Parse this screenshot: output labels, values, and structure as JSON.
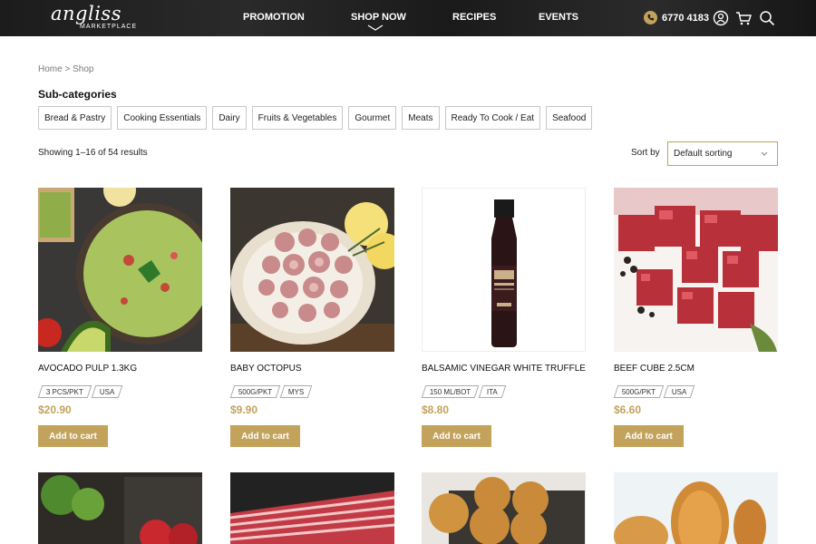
{
  "header": {
    "logo_script": "angliss",
    "logo_sub": "MARKETPLACE",
    "nav": [
      {
        "label": "PROMOTION"
      },
      {
        "label": "SHOP NOW"
      },
      {
        "label": "RECIPES"
      },
      {
        "label": "EVENTS"
      }
    ],
    "phone": "6770 4183",
    "icons": [
      "phone-icon",
      "user-icon",
      "cart-icon",
      "search-icon"
    ]
  },
  "breadcrumb": {
    "home": "Home",
    "separator": ">",
    "current": "Shop"
  },
  "subcategories": {
    "title": "Sub-categories",
    "items": [
      "Bread & Pastry",
      "Cooking Essentials",
      "Dairy",
      "Fruits & Vegetables",
      "Gourmet",
      "Meats",
      "Ready To Cook / Eat",
      "Seafood"
    ]
  },
  "results": {
    "text": "Showing 1–16 of 54 results"
  },
  "sort": {
    "label": "Sort by",
    "value": "Default sorting"
  },
  "products": [
    {
      "name": "AVOCADO PULP 1.3KG",
      "tags": [
        "3 PCS/PKT",
        "USA"
      ],
      "price": "$20.90",
      "button": "Add to cart",
      "image": "guacamole bowl"
    },
    {
      "name": "BABY OCTOPUS",
      "tags": [
        "500G/PKT",
        "MYS"
      ],
      "price": "$9.90",
      "button": "Add to cart",
      "image": "baby octopus plate"
    },
    {
      "name": "BALSAMIC VINEGAR WHITE TRUFFLE",
      "tags": [
        "150 ML/BOT",
        "ITA"
      ],
      "price": "$8.80",
      "button": "Add to cart",
      "image": "vinegar bottle"
    },
    {
      "name": "BEEF CUBE 2.5CM",
      "tags": [
        "500G/PKT",
        "USA"
      ],
      "price": "$6.60",
      "button": "Add to cart",
      "image": "beef cubes"
    }
  ],
  "colors": {
    "accent": "#c3a25c",
    "header_bg": "#1f1f1f"
  }
}
